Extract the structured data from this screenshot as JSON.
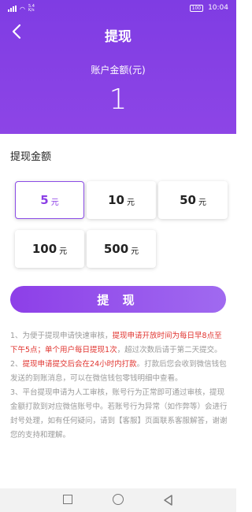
{
  "status_bar": {
    "speed_value": "5.4",
    "speed_unit": "K/s",
    "battery": "100",
    "time": "10:04"
  },
  "header": {
    "title": "提现",
    "balance_label": "账户金额(元)",
    "balance_value": "1"
  },
  "amount_section": {
    "title": "提现金额",
    "options": [
      {
        "value": "5",
        "unit": "元"
      },
      {
        "value": "10",
        "unit": "元"
      },
      {
        "value": "50",
        "unit": "元"
      },
      {
        "value": "100",
        "unit": "元"
      },
      {
        "value": "500",
        "unit": "元"
      }
    ],
    "selected_index": 0
  },
  "withdraw_button": "提 现",
  "notes": {
    "n1_a": "1、为便于提现申请快速审核，",
    "n1_b": "提现申请开放时间为每日早8点至下午5点；单个用户每日提现1次",
    "n1_c": "，超过次数后请于第二天提交。",
    "n2_a": "2、",
    "n2_b": "提现申请提交后会在24小时内打款",
    "n2_c": "。打款后您会收到微信钱包发送的到账消息，可以在微信钱包零钱明细中查看。",
    "n3": "3、平台提现申请为人工审核，账号行为正常即可通过审核，提现金额打款到对应微信账号中。若账号行为异常（如作弊等）会进行封号处理，如有任何疑问，请到【客服】页面联系客服解答，谢谢您的支持和理解。"
  },
  "colors": {
    "primary": "#8b3ee6",
    "warning_text": "#e0342f"
  }
}
